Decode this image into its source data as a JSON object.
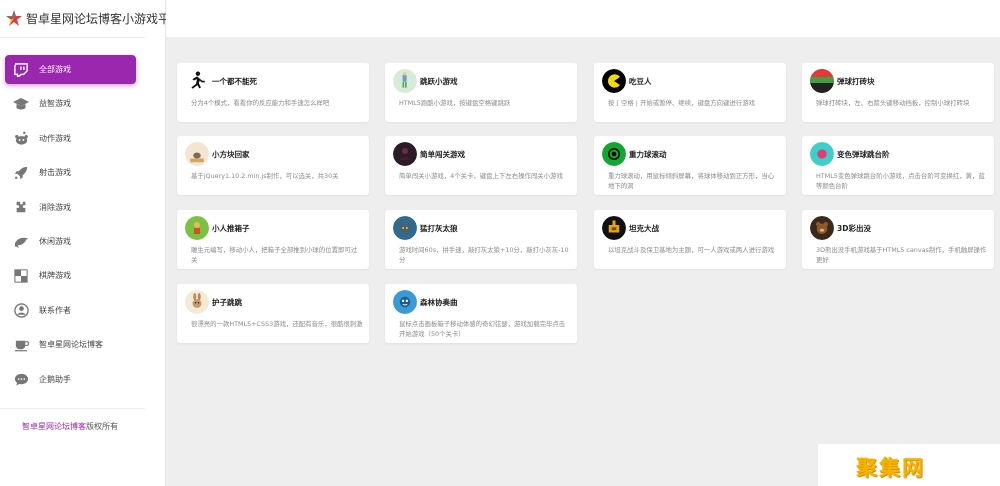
{
  "brand": {
    "title": "智卓星网论坛博客小游戏平台"
  },
  "nav": [
    {
      "label": "全部游戏",
      "icon": "twitch-icon",
      "active": true
    },
    {
      "label": "益智游戏",
      "icon": "graduation-cap-icon"
    },
    {
      "label": "动作游戏",
      "icon": "reddit-icon"
    },
    {
      "label": "射击游戏",
      "icon": "rocket-icon"
    },
    {
      "label": "消除游戏",
      "icon": "puzzle-icon"
    },
    {
      "label": "休闲游戏",
      "icon": "dolphin-icon"
    },
    {
      "label": "棋牌游戏",
      "icon": "chessboard-icon"
    },
    {
      "label": "联系作者",
      "icon": "user-icon"
    },
    {
      "label": "智卓星网论坛博客",
      "icon": "coffee-icon"
    },
    {
      "label": "企鹅助手",
      "icon": "chat-icon"
    }
  ],
  "footer": {
    "link": "智卓星网论坛博客",
    "suffix": "版权所有"
  },
  "games": [
    {
      "title": "一个都不能死",
      "desc": "分为4个模式，看看你的反应能力和手速怎么样吧",
      "icon": "runner-icon"
    },
    {
      "title": "跳跃小游戏",
      "desc": "HTML5跑酷小游戏，按键盘空格键跳跃",
      "icon": "jumper-icon"
    },
    {
      "title": "吃豆人",
      "desc": "按 [ 空格 | 开始或暂停、继续，键盘方向键进行游戏",
      "icon": "pacman-icon"
    },
    {
      "title": "弹球打砖块",
      "desc": "弹球打砖块，左、右箭头键移动挡板，控制小球打砖块",
      "icon": "brick-icon"
    },
    {
      "title": "小方块回家",
      "desc": "基于jQuery1.10.2.min.js制作，可以选关，共30关",
      "icon": "block-icon"
    },
    {
      "title": "简单闯关游戏",
      "desc": "简单闯关小游戏，4个关卡，键盘上下左右操作闯关小游戏",
      "icon": "adventure-icon"
    },
    {
      "title": "重力球滚动",
      "desc": "重力球滚动，用鼠标倾斜屏幕，将球体移动到正方形，当心地下的洞",
      "icon": "ball-icon"
    },
    {
      "title": "变色弹球跳台阶",
      "desc": "HTML5变色弹球跳台阶小游戏，点击台阶可变换红，黄，蓝等颜色台阶",
      "icon": "color-ball-icon"
    },
    {
      "title": "小人推箱子",
      "desc": "雕生元编写，移动小人，把箱子全部推到小球的位置即可过关",
      "icon": "sokoban-icon"
    },
    {
      "title": "猛打灰太狼",
      "desc": "游戏时间60s，拼手速，敲打灰太狼+10分，敲打小灰灰-10分",
      "icon": "wolf-icon"
    },
    {
      "title": "坦克大战",
      "desc": "以坦克战斗及保卫基地为主题，可一人游戏或两人进行游戏",
      "icon": "tank-icon"
    },
    {
      "title": "3D彩出没",
      "desc": "3D熊出没手机游戏基于HTML5 canvas制作，手机触屏操作更好",
      "icon": "bear-icon"
    },
    {
      "title": "护子跳跳",
      "desc": "很漂亮的一款HTML5+CSS3游戏，还配有音乐，很酷很刺激",
      "icon": "rabbit-icon"
    },
    {
      "title": "森林协奏曲",
      "desc": "鼠标点击画板箱子移动体感的奇幻弦瑟，游戏加载完毕点击开始游戏（50个关卡）",
      "icon": "forest-icon"
    }
  ],
  "watermark": "聚集网"
}
